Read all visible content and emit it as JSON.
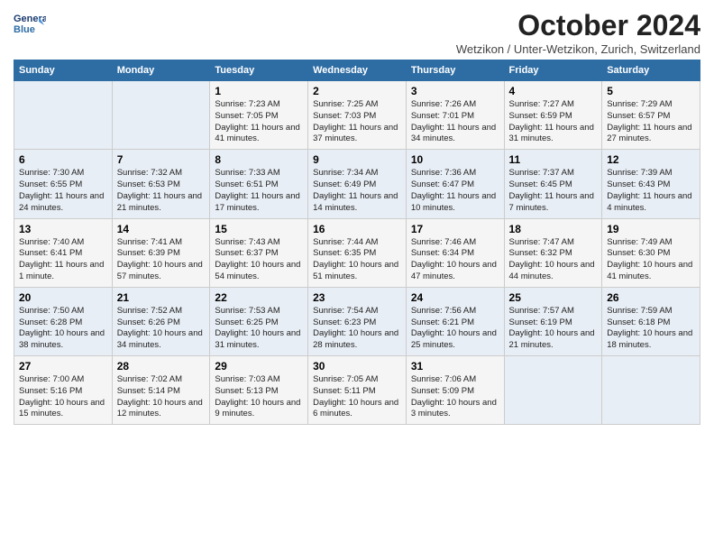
{
  "header": {
    "logo_line1": "General",
    "logo_line2": "Blue",
    "month": "October 2024",
    "location": "Wetzikon / Unter-Wetzikon, Zurich, Switzerland"
  },
  "weekdays": [
    "Sunday",
    "Monday",
    "Tuesday",
    "Wednesday",
    "Thursday",
    "Friday",
    "Saturday"
  ],
  "weeks": [
    [
      {
        "day": "",
        "info": ""
      },
      {
        "day": "",
        "info": ""
      },
      {
        "day": "1",
        "info": "Sunrise: 7:23 AM\nSunset: 7:05 PM\nDaylight: 11 hours and 41 minutes."
      },
      {
        "day": "2",
        "info": "Sunrise: 7:25 AM\nSunset: 7:03 PM\nDaylight: 11 hours and 37 minutes."
      },
      {
        "day": "3",
        "info": "Sunrise: 7:26 AM\nSunset: 7:01 PM\nDaylight: 11 hours and 34 minutes."
      },
      {
        "day": "4",
        "info": "Sunrise: 7:27 AM\nSunset: 6:59 PM\nDaylight: 11 hours and 31 minutes."
      },
      {
        "day": "5",
        "info": "Sunrise: 7:29 AM\nSunset: 6:57 PM\nDaylight: 11 hours and 27 minutes."
      }
    ],
    [
      {
        "day": "6",
        "info": "Sunrise: 7:30 AM\nSunset: 6:55 PM\nDaylight: 11 hours and 24 minutes."
      },
      {
        "day": "7",
        "info": "Sunrise: 7:32 AM\nSunset: 6:53 PM\nDaylight: 11 hours and 21 minutes."
      },
      {
        "day": "8",
        "info": "Sunrise: 7:33 AM\nSunset: 6:51 PM\nDaylight: 11 hours and 17 minutes."
      },
      {
        "day": "9",
        "info": "Sunrise: 7:34 AM\nSunset: 6:49 PM\nDaylight: 11 hours and 14 minutes."
      },
      {
        "day": "10",
        "info": "Sunrise: 7:36 AM\nSunset: 6:47 PM\nDaylight: 11 hours and 10 minutes."
      },
      {
        "day": "11",
        "info": "Sunrise: 7:37 AM\nSunset: 6:45 PM\nDaylight: 11 hours and 7 minutes."
      },
      {
        "day": "12",
        "info": "Sunrise: 7:39 AM\nSunset: 6:43 PM\nDaylight: 11 hours and 4 minutes."
      }
    ],
    [
      {
        "day": "13",
        "info": "Sunrise: 7:40 AM\nSunset: 6:41 PM\nDaylight: 11 hours and 1 minute."
      },
      {
        "day": "14",
        "info": "Sunrise: 7:41 AM\nSunset: 6:39 PM\nDaylight: 10 hours and 57 minutes."
      },
      {
        "day": "15",
        "info": "Sunrise: 7:43 AM\nSunset: 6:37 PM\nDaylight: 10 hours and 54 minutes."
      },
      {
        "day": "16",
        "info": "Sunrise: 7:44 AM\nSunset: 6:35 PM\nDaylight: 10 hours and 51 minutes."
      },
      {
        "day": "17",
        "info": "Sunrise: 7:46 AM\nSunset: 6:34 PM\nDaylight: 10 hours and 47 minutes."
      },
      {
        "day": "18",
        "info": "Sunrise: 7:47 AM\nSunset: 6:32 PM\nDaylight: 10 hours and 44 minutes."
      },
      {
        "day": "19",
        "info": "Sunrise: 7:49 AM\nSunset: 6:30 PM\nDaylight: 10 hours and 41 minutes."
      }
    ],
    [
      {
        "day": "20",
        "info": "Sunrise: 7:50 AM\nSunset: 6:28 PM\nDaylight: 10 hours and 38 minutes."
      },
      {
        "day": "21",
        "info": "Sunrise: 7:52 AM\nSunset: 6:26 PM\nDaylight: 10 hours and 34 minutes."
      },
      {
        "day": "22",
        "info": "Sunrise: 7:53 AM\nSunset: 6:25 PM\nDaylight: 10 hours and 31 minutes."
      },
      {
        "day": "23",
        "info": "Sunrise: 7:54 AM\nSunset: 6:23 PM\nDaylight: 10 hours and 28 minutes."
      },
      {
        "day": "24",
        "info": "Sunrise: 7:56 AM\nSunset: 6:21 PM\nDaylight: 10 hours and 25 minutes."
      },
      {
        "day": "25",
        "info": "Sunrise: 7:57 AM\nSunset: 6:19 PM\nDaylight: 10 hours and 21 minutes."
      },
      {
        "day": "26",
        "info": "Sunrise: 7:59 AM\nSunset: 6:18 PM\nDaylight: 10 hours and 18 minutes."
      }
    ],
    [
      {
        "day": "27",
        "info": "Sunrise: 7:00 AM\nSunset: 5:16 PM\nDaylight: 10 hours and 15 minutes."
      },
      {
        "day": "28",
        "info": "Sunrise: 7:02 AM\nSunset: 5:14 PM\nDaylight: 10 hours and 12 minutes."
      },
      {
        "day": "29",
        "info": "Sunrise: 7:03 AM\nSunset: 5:13 PM\nDaylight: 10 hours and 9 minutes."
      },
      {
        "day": "30",
        "info": "Sunrise: 7:05 AM\nSunset: 5:11 PM\nDaylight: 10 hours and 6 minutes."
      },
      {
        "day": "31",
        "info": "Sunrise: 7:06 AM\nSunset: 5:09 PM\nDaylight: 10 hours and 3 minutes."
      },
      {
        "day": "",
        "info": ""
      },
      {
        "day": "",
        "info": ""
      }
    ]
  ]
}
